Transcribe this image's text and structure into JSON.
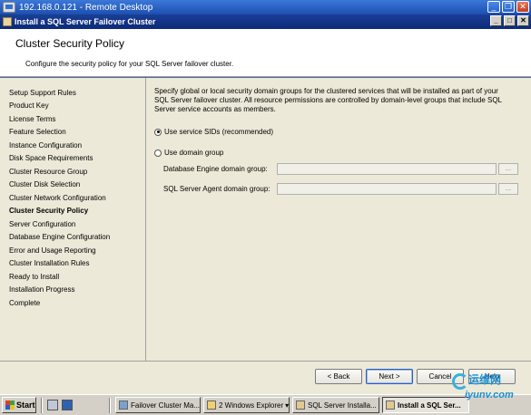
{
  "rdp": {
    "title": "192.168.0.121 - Remote Desktop"
  },
  "dialog": {
    "title": "Install a SQL Server Failover Cluster"
  },
  "header": {
    "title": "Cluster Security Policy",
    "subtitle": "Configure the security policy for your SQL Server failover cluster."
  },
  "nav": {
    "items": [
      {
        "label": "Setup Support Rules"
      },
      {
        "label": "Product Key"
      },
      {
        "label": "License Terms"
      },
      {
        "label": "Feature Selection"
      },
      {
        "label": "Instance Configuration"
      },
      {
        "label": "Disk Space Requirements"
      },
      {
        "label": "Cluster Resource Group"
      },
      {
        "label": "Cluster Disk Selection"
      },
      {
        "label": "Cluster Network Configuration"
      },
      {
        "label": "Cluster Security Policy",
        "active": true
      },
      {
        "label": "Server Configuration"
      },
      {
        "label": "Database Engine Configuration"
      },
      {
        "label": "Error and Usage Reporting"
      },
      {
        "label": "Cluster Installation Rules"
      },
      {
        "label": "Ready to Install"
      },
      {
        "label": "Installation Progress"
      },
      {
        "label": "Complete"
      }
    ]
  },
  "content": {
    "description": "Specify global or local security domain groups for the clustered services that will be installed as part of your SQL Server failover cluster. All resource permissions are controlled by domain-level groups that include SQL Server service accounts as members.",
    "option_sids": "Use service SIDs (recommended)",
    "option_domain": "Use domain group",
    "selected_option": "sids",
    "db_engine_label": "Database Engine domain group:",
    "db_engine_value": "",
    "agent_label": "SQL Server Agent domain group:",
    "agent_value": "",
    "browse_label": "..."
  },
  "buttons": {
    "back": "< Back",
    "next": "Next >",
    "cancel": "Cancel",
    "help": "Help"
  },
  "taskbar": {
    "start": "Start",
    "tasks": [
      {
        "label": "Failover Cluster Ma...",
        "icon": "cluster-icon"
      },
      {
        "label": "2 Windows Explorer",
        "icon": "folder-icon"
      },
      {
        "label": "SQL Server Installa...",
        "icon": "installer-icon"
      },
      {
        "label": "Install a SQL Ser...",
        "icon": "installer-icon",
        "active": true
      }
    ]
  },
  "watermark": {
    "text_cn": "运维网",
    "url": "iyunv.com"
  }
}
